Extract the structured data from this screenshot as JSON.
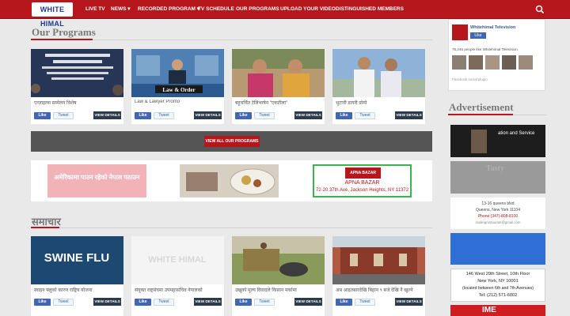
{
  "nav": {
    "logo": "WHITE HIMAL",
    "items": [
      {
        "label": "LIVE TV"
      },
      {
        "label": "NEWS ▾"
      },
      {
        "label": "RECORDED PROGRAM ▾"
      },
      {
        "label": "TV SCHEDULE"
      },
      {
        "label": "OUR PROGRAMS"
      },
      {
        "label": "UPLOAD YOUR VIDEO"
      },
      {
        "label": "DISTINGUISHED MEMBERS"
      }
    ],
    "search_icon": "search-icon"
  },
  "programs": {
    "heading": "Our Programs",
    "cards": [
      {
        "caption": "एन्जाइल्स सम्मेलन विशेष",
        "like": "Like",
        "tweet": "Tweet",
        "view": "VIEW DETAILS"
      },
      {
        "caption": "Law & Lawyer Promo",
        "thumb_text": "Law & Order",
        "like": "Like",
        "tweet": "Tweet",
        "view": "VIEW DETAILS"
      },
      {
        "caption": "बहुचर्चित टेलिभाषेन \"एकटीला\"",
        "like": "Like",
        "tweet": "Tweet",
        "view": "VIEW DETAILS"
      },
      {
        "caption": "भुटानी डायरी प्रोमो",
        "like": "Like",
        "tweet": "Tweet",
        "view": "VIEW DETAILS"
      }
    ],
    "view_all": "VIEW ALL OUR PROGRAMS"
  },
  "banners": {
    "left_text": "अमेरिकामा पाउन रहेको नेपाल पठाउन",
    "right_title": "APNA BAZAR",
    "right_sub1": "APNA BAZAR",
    "right_sub2": "72-20 37th Ave, Jackson Heights, NY 11372"
  },
  "news": {
    "heading": "समाचार",
    "cards": [
      {
        "caption": "स्वाइन फ्लूको कारण राष्ट्रिय योजना",
        "thumb_text": "SWINE FLU",
        "like": "Like",
        "tweet": "Tweet",
        "view": "VIEW DETAILS"
      },
      {
        "caption": "संयुक्त राष्ट्रसंघमा उपमहासचिव नेपालको",
        "thumb_text": "WHITE HIMAL",
        "like": "Like",
        "tweet": "Tweet",
        "view": "VIEW DETAILS"
      },
      {
        "caption": "उखुको मूल्य विवादले किसान मर्कामा",
        "like": "Like",
        "tweet": "Tweet",
        "view": "VIEW DETAILS"
      },
      {
        "caption": "अब आइतबारदेखि बिहान ९ बजे देखि नै खुल्ने",
        "like": "Like",
        "tweet": "Tweet",
        "view": "VIEW DETAILS"
      }
    ]
  },
  "sidebar": {
    "fb_page_name": "Whitehimal Television",
    "fb_like": "Like",
    "fb_count": "78,245 people like Whitehimal Television.",
    "fb_plugin": "Facebook social plugin",
    "ad_heading": "Advertisement",
    "ads": [
      {
        "text": "ation and Service"
      },
      {
        "text": "Tasty"
      },
      {
        "line1": "13-16 queens blvd",
        "line2": "Queens, New York 11104",
        "line3": "Phone:(347)-808-8100",
        "line4": "mailingrestaurant@gmail.com"
      },
      {
        "text": ""
      },
      {
        "line1": "146 West 29th Street, 10th Floor",
        "line2": "New York, NY 10001",
        "line3": "(located between 6th and 7th Avenues)",
        "line4": "Tel: (212) 571-6002"
      },
      {
        "text": "IME"
      }
    ]
  },
  "colors": {
    "brand_red": "#b5171c",
    "dark_button": "#2b3b4b",
    "fb_blue": "#4267b2"
  }
}
